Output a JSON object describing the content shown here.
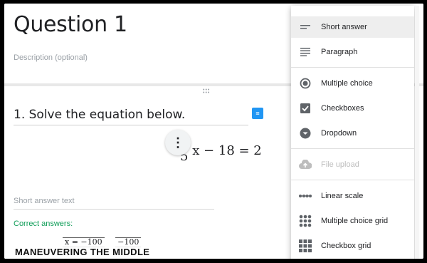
{
  "form": {
    "title": "Question 1",
    "description_placeholder": "Description (optional)",
    "question": "1. Solve the equation below.",
    "equation": {
      "numerator": "5",
      "text": "x − 18 = 2"
    },
    "short_answer_placeholder": "Short answer text",
    "correct_answers_label": "Correct answers:",
    "answers": [
      "x = −100",
      "−100"
    ]
  },
  "branding": {
    "watermark": "MANEUVERING THE MIDDLE"
  },
  "menu": {
    "items": [
      {
        "label": "Short answer",
        "icon": "short-answer-icon"
      },
      {
        "label": "Paragraph",
        "icon": "paragraph-icon"
      },
      {
        "label": "Multiple choice",
        "icon": "radio-icon"
      },
      {
        "label": "Checkboxes",
        "icon": "checkbox-icon"
      },
      {
        "label": "Dropdown",
        "icon": "dropdown-icon"
      },
      {
        "label": "File upload",
        "icon": "cloud-upload-icon"
      },
      {
        "label": "Linear scale",
        "icon": "linear-scale-icon"
      },
      {
        "label": "Multiple choice grid",
        "icon": "grid-icon"
      },
      {
        "label": "Checkbox grid",
        "icon": "checkbox-grid-icon"
      }
    ]
  },
  "colors": {
    "accent": "#2196f3",
    "correct": "#0f9d58",
    "icon": "#5f6368"
  }
}
